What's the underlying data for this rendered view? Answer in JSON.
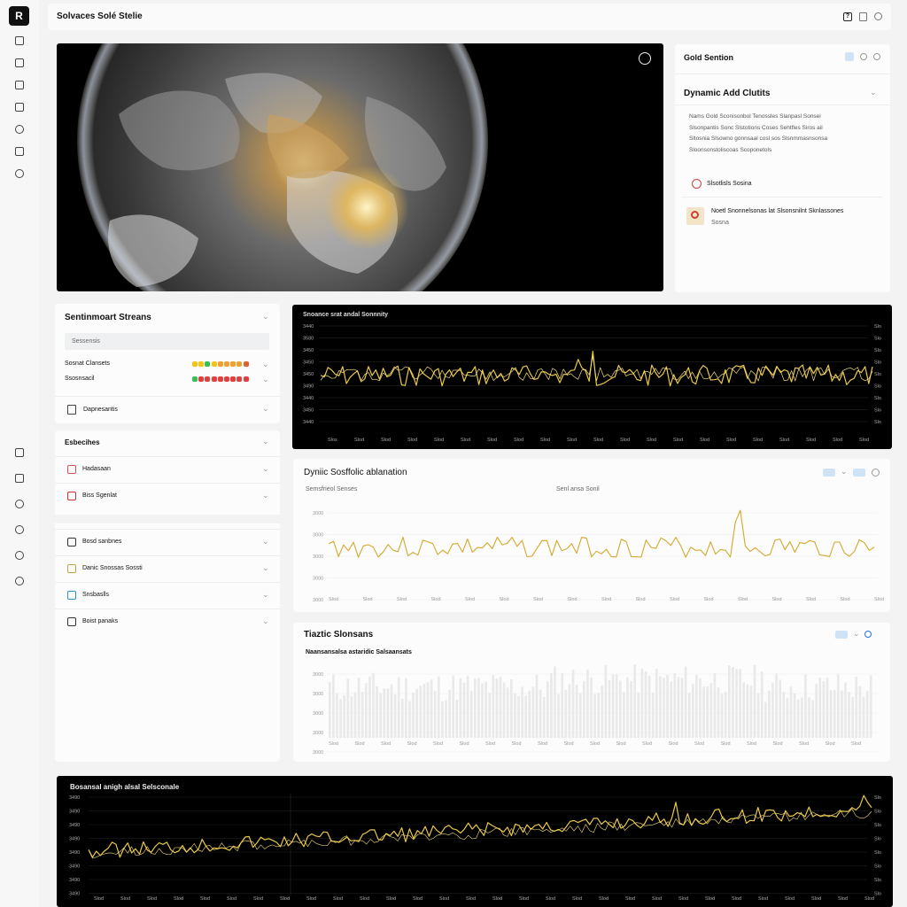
{
  "app": {
    "logo_glyph": "R",
    "title": "Solvaces Solé Stelie"
  },
  "topbar_icons": [
    "help-icon",
    "copy-icon",
    "settings-icon"
  ],
  "left_rail": {
    "top_icons": [
      "document-icon",
      "list-icon",
      "window-icon",
      "chart-icon",
      "info-icon",
      "folder-icon",
      "clock-icon"
    ],
    "bottom_icons": [
      "inbox-icon",
      "layers-icon",
      "settings-icon",
      "globe-icon",
      "timer-icon",
      "help-circle-icon"
    ]
  },
  "earth_view": {
    "corner_icon": "fullscreen-icon"
  },
  "right_panel": {
    "header_title": "Gold Sention",
    "card_title": "Dynamic Add Clutits",
    "body_lines": [
      "Nams Gold Sconisonbol Tenossles Slanpasl Sonsei",
      "Slsonpantis Sonc Slstotions Coses Sehtfles Siros ail",
      "Sltosnia Slsowno gonnsaal cosl sos Slsnmmasnsonsa",
      "Sloonsonstoliscoas Scoponetols"
    ],
    "status_label": "Slsotlisls Sosina",
    "item_text": "Noetl Snonnelsonas lat Slsonsnilnt Sknlassones",
    "item_sub": "Sosna"
  },
  "sentiment": {
    "title": "Sentinmoart Streans",
    "input_placeholder": "Sessensis",
    "rows": [
      {
        "label": "Sosnat Clansets",
        "dots": [
          "#f0c419",
          "#f0c419",
          "#38c152",
          "#f0c419",
          "#f0a030",
          "#f0a030",
          "#f0a030",
          "#f0a030",
          "#e06030"
        ]
      },
      {
        "label": "Ssosnsacil",
        "dots": [
          "#38c152",
          "#e04040",
          "#e04040",
          "#e04040",
          "#e04040",
          "#e04040",
          "#e04040",
          "#e04040",
          "#e04040"
        ]
      }
    ],
    "extra_item": "Dapnesantis"
  },
  "sidebar_sections": [
    {
      "title": "Esbecihes",
      "items": [
        {
          "label": "Hadasaan",
          "color": "#e05050"
        },
        {
          "label": "Biss Sgenlat",
          "color": "#d03030"
        }
      ]
    },
    {
      "title": "",
      "items": [
        {
          "label": "Bosd sanbnes",
          "color": "#333"
        },
        {
          "label": "Danic Snossas Sossti",
          "color": "#c8a040"
        },
        {
          "label": "Snsbaslls",
          "color": "#2a8fd8"
        },
        {
          "label": "Boist panaks",
          "color": "#333"
        }
      ]
    }
  ],
  "dark_chart_top": {
    "title": "Snoance srat andal Sonnnity",
    "y_ticks": [
      "3440",
      "3580",
      "3450",
      "3450",
      "3450",
      "3490",
      "3440",
      "3450",
      "3440"
    ],
    "x_ticks": [
      "Slos",
      "Slod",
      "Slod",
      "Slod",
      "Slod",
      "Slod",
      "Slod",
      "Slod",
      "Slod",
      "Slod",
      "Slod",
      "Slod",
      "Slod",
      "Slod",
      "Slod",
      "Slod",
      "Slod",
      "Slod",
      "Slod",
      "Slod",
      "Slod"
    ]
  },
  "white_chart": {
    "title": "Dyniic Sosffolic ablanation",
    "sub_left": "Semsfrieol Senses",
    "sub_right": "Senl ansa Sonil",
    "y_ticks": [
      "3000",
      "3000",
      "3000",
      "3000",
      "3000"
    ],
    "x_ticks": [
      "Slod",
      "Slod",
      "Slod",
      "Slod",
      "Slod",
      "Slod",
      "Slod",
      "Slod",
      "Slod",
      "Slod",
      "Slod",
      "Slod",
      "Slod",
      "Slod",
      "Slod",
      "Slod",
      "Slod"
    ]
  },
  "bars_chart": {
    "title": "Tiaztic Slonsans",
    "subtitle": "Naansansalsa astaridic Salsaansats",
    "y_ticks": [
      "3000",
      "3000",
      "3000",
      "3000",
      "3000"
    ],
    "x_ticks": [
      "Slod",
      "Slod",
      "Slod",
      "Slod",
      "Slod",
      "Slod",
      "Slod",
      "Slod",
      "Slod",
      "Slod",
      "Slod",
      "Slod",
      "Slod",
      "Slod",
      "Slod",
      "Slod",
      "Slod",
      "Slod",
      "Slod",
      "Slod",
      "Slod"
    ]
  },
  "dark_chart_bottom": {
    "title": "Bosansal anigh alsal Selsconale",
    "y_ticks": [
      "3490",
      "3490",
      "3490",
      "3490",
      "3490",
      "3490",
      "3490",
      "3490"
    ],
    "x_ticks": [
      "Slod",
      "Slod",
      "Slod",
      "Slod",
      "Slod",
      "Slod",
      "Slod",
      "Slod",
      "Slod",
      "Slod",
      "Slod",
      "Slod",
      "Slod",
      "Slod",
      "Slod",
      "Slod",
      "Slod",
      "Slod",
      "Slod",
      "Slod",
      "Slod",
      "Slod",
      "Slod",
      "Slod",
      "Slod",
      "Slod",
      "Slod",
      "Slod",
      "Slod",
      "Slod"
    ]
  },
  "colors": {
    "gold": "#e8c84a",
    "gold_dark": "#d4a82a",
    "accent_blue": "#3a8ee6"
  }
}
